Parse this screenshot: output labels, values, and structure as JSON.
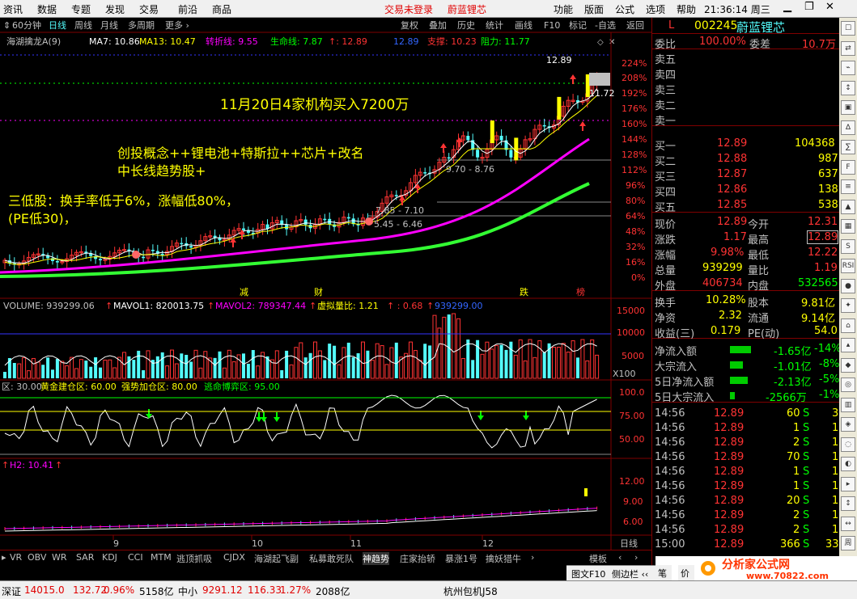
{
  "menubar": {
    "left_items": [
      "资讯",
      "数据",
      "专题",
      "发现",
      "交易",
      "前沿",
      "商品"
    ],
    "center_items": [
      "交易未登录",
      "蔚蓝锂芯"
    ],
    "right_items": [
      "功能",
      "版面",
      "公式",
      "选项",
      "帮助"
    ],
    "clock": "21:36:14 周三"
  },
  "toolbar": {
    "left_items": [
      "60分钟",
      "日线",
      "周线",
      "月线",
      "多周期",
      "更多 ›"
    ],
    "right_items": [
      "复权",
      "叠加",
      "历史",
      "统计",
      "画线",
      "F10",
      "标记",
      "-自选",
      "返回"
    ]
  },
  "indicators": {
    "main_line": [
      "海湖擒龙A(9)",
      "MA7: 10.86",
      "MA13: 10.47",
      "转折线: 9.55",
      "生命线: 7.87",
      "↑: 12.89",
      "12.89",
      "支撑: 10.23",
      "阻力: 11.77"
    ],
    "volume_line": [
      "VOLUME: 939299.06",
      "↑",
      "MAVOL1: 820013.75",
      "↑",
      "MAVOL2: 789347.44",
      "↑",
      "虚拟量比: 1.21",
      "↑ : 0.68",
      "↑",
      "939299.00"
    ],
    "osc_line": [
      "区: 30.00",
      "黄金建仓区: 60.00",
      "强势加仓区: 80.00",
      "逃命博弈区: 95.00"
    ],
    "h2_line": [
      "↑",
      "H2: 10.41",
      "↑"
    ]
  },
  "annotations": {
    "a1": "11月20日4家机构买入7200万",
    "a2": "创投概念++锂电池+特斯拉++芯片+改名",
    "a3": "中长线趋势股+",
    "a4": "三低股：换手率低于6%，涨幅低80%，",
    "a5": "(PE低30)，"
  },
  "price_labels": [
    "12.89",
    "11.72",
    "9.70 - 8.76",
    "7.85 - 7.10",
    "5.45 - 6.46"
  ],
  "main_axis": [
    "224%",
    "208%",
    "192%",
    "176%",
    "160%",
    "144%",
    "128%",
    "112%",
    "96%",
    "80%",
    "64%",
    "48%",
    "32%",
    "16%",
    "0%"
  ],
  "vol_axis": [
    "15000",
    "10000",
    "5000",
    "X100"
  ],
  "osc_axis": [
    "100.0",
    "75.00",
    "50.00"
  ],
  "h2_axis": [
    "12.00",
    "9.00",
    "6.00"
  ],
  "time_axis": [
    "9",
    "10",
    "11",
    "12"
  ],
  "period_label": "日线",
  "event_markers": [
    "减",
    "财",
    "跌",
    "榜"
  ],
  "tabs": [
    "VR",
    "OBV",
    "WR",
    "SAR",
    "KDJ",
    "CCI",
    "MTM",
    "逃顶抓吸",
    "CJDX",
    "海湖起飞副",
    "私募敢死队",
    "神趋势",
    "庄家抬轿",
    "暴涨1号",
    "擒妖猎牛",
    "›"
  ],
  "tab_active": "神趋势",
  "tab_right": [
    "模板",
    "‹",
    "›"
  ],
  "right_panel": {
    "flag": "L",
    "code": "002245",
    "name": "蔚蓝锂芯",
    "weibi_label": "委比",
    "weibi_value": "100.00%",
    "weicha_label": "委差",
    "weicha_value": "10.7万",
    "sell_labels": [
      "卖五",
      "卖四",
      "卖三",
      "卖二",
      "卖一"
    ],
    "buy": [
      {
        "label": "买一",
        "price": "12.89",
        "vol": "104368"
      },
      {
        "label": "买二",
        "price": "12.88",
        "vol": "987"
      },
      {
        "label": "买三",
        "price": "12.87",
        "vol": "637"
      },
      {
        "label": "买四",
        "price": "12.86",
        "vol": "138"
      },
      {
        "label": "买五",
        "price": "12.85",
        "vol": "538"
      }
    ],
    "stats": [
      {
        "l1": "现价",
        "v1": "12.89",
        "l2": "今开",
        "v2": "12.31"
      },
      {
        "l1": "涨跌",
        "v1": "1.17",
        "l2": "最高",
        "v2": "12.89"
      },
      {
        "l1": "涨幅",
        "v1": "9.98%",
        "l2": "最低",
        "v2": "12.22"
      },
      {
        "l1": "总量",
        "v1": "939299",
        "l2": "量比",
        "v2": "1.19"
      },
      {
        "l1": "外盘",
        "v1": "406734",
        "l2": "内盘",
        "v2": "532565"
      }
    ],
    "stats2": [
      {
        "l1": "换手",
        "v1": "10.28%",
        "l2": "股本",
        "v2": "9.81亿"
      },
      {
        "l1": "净资",
        "v1": "2.32",
        "l2": "流通",
        "v2": "9.14亿"
      },
      {
        "l1": "收益(三)",
        "v1": "0.179",
        "l2": "PE(动)",
        "v2": "54.0"
      }
    ],
    "flows": [
      {
        "label": "净流入额",
        "value": "-1.65亿",
        "pct": "-14%"
      },
      {
        "label": "大宗流入",
        "value": "-1.01亿",
        "pct": "-8%"
      },
      {
        "label": "5日净流入额",
        "value": "-2.13亿",
        "pct": "-5%"
      },
      {
        "label": "5日大宗流入",
        "value": "-2566万",
        "pct": "-1%"
      }
    ],
    "ticks": [
      {
        "t": "14:56",
        "p": "12.89",
        "v": "60",
        "s": "S",
        "n": "3"
      },
      {
        "t": "14:56",
        "p": "12.89",
        "v": "1",
        "s": "S",
        "n": "1"
      },
      {
        "t": "14:56",
        "p": "12.89",
        "v": "2",
        "s": "S",
        "n": "1"
      },
      {
        "t": "14:56",
        "p": "12.89",
        "v": "70",
        "s": "S",
        "n": "1"
      },
      {
        "t": "14:56",
        "p": "12.89",
        "v": "1",
        "s": "S",
        "n": "1"
      },
      {
        "t": "14:56",
        "p": "12.89",
        "v": "1",
        "s": "S",
        "n": "1"
      },
      {
        "t": "14:56",
        "p": "12.89",
        "v": "20",
        "s": "S",
        "n": "1"
      },
      {
        "t": "14:56",
        "p": "12.89",
        "v": "2",
        "s": "S",
        "n": "1"
      },
      {
        "t": "14:56",
        "p": "12.89",
        "v": "2",
        "s": "S",
        "n": "1"
      },
      {
        "t": "15:00",
        "p": "12.89",
        "v": "366",
        "s": "S",
        "n": "33"
      }
    ],
    "tail_buttons": [
      "图文F10",
      "侧边栏 ‹‹",
      "笔",
      "价"
    ]
  },
  "iconbar": [
    "☐",
    "⇄",
    "⌁",
    "↕",
    "▣",
    "∆",
    "∑",
    "F",
    "≡",
    "▲",
    "▦",
    "S",
    "RSI",
    "●",
    "✦",
    "⌂",
    "▴",
    "◆",
    "◎",
    "▥",
    "◈",
    "◌",
    "◐",
    "▸",
    "↕",
    "↔",
    "周"
  ],
  "bottombar": {
    "items": [
      {
        "label": "深证",
        "value": "14015.0",
        "chg": "132.72",
        "pct": "0.96%",
        "amt": "5158亿"
      },
      {
        "label": "中小",
        "value": "9291.12",
        "chg": "116.33",
        "pct": "1.27%",
        "amt": "2088亿"
      }
    ],
    "extra": "杭州包机J58"
  },
  "logo": {
    "text1": "分析家公式网",
    "text2": "www.70822.com"
  },
  "colors": {
    "red": "#ff3333",
    "cyan": "#54fcfc",
    "yellow": "#ffff00",
    "magenta": "#ff00ff",
    "green": "#00ff00",
    "white": "#ffffff"
  }
}
